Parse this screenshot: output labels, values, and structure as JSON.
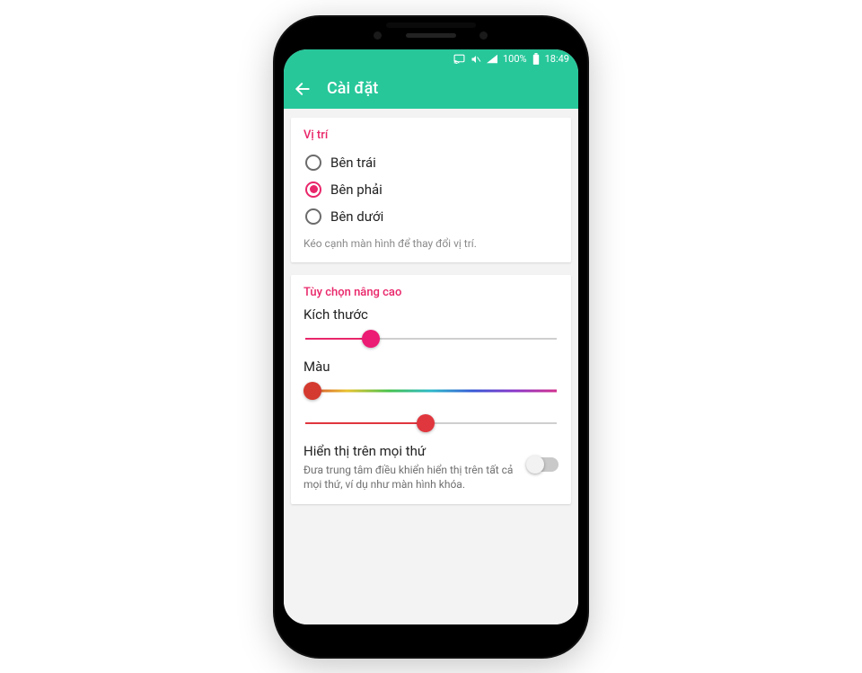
{
  "colors": {
    "accent": "#27c79a",
    "brand": "#e9266a",
    "sliderRed": "#e0363e"
  },
  "status": {
    "battery": "100%",
    "time": "18:49"
  },
  "appbar": {
    "title": "Cài đặt",
    "back_icon": "arrow-left-icon"
  },
  "status_icons": [
    "cast-icon",
    "mute-icon",
    "signal-icon",
    "battery-icon"
  ],
  "position": {
    "section_title": "Vị trí",
    "options": [
      {
        "label": "Bên trái",
        "selected": false
      },
      {
        "label": "Bên phải",
        "selected": true
      },
      {
        "label": "Bên dưới",
        "selected": false
      }
    ],
    "hint": "Kéo cạnh màn hình để thay đổi vị trí."
  },
  "advanced": {
    "section_title": "Tùy chọn nâng cao",
    "size_label": "Kích thước",
    "size_value_pct": 26,
    "color_label": "Màu",
    "hue_value_pct": 3,
    "sat_value_pct": 48,
    "overlay_title": "Hiển thị trên mọi thứ",
    "overlay_desc": "Đưa trung tâm điều khiển hiển thị trên tất cả mọi thứ, ví dụ như màn hình khóa.",
    "overlay_on": false
  }
}
